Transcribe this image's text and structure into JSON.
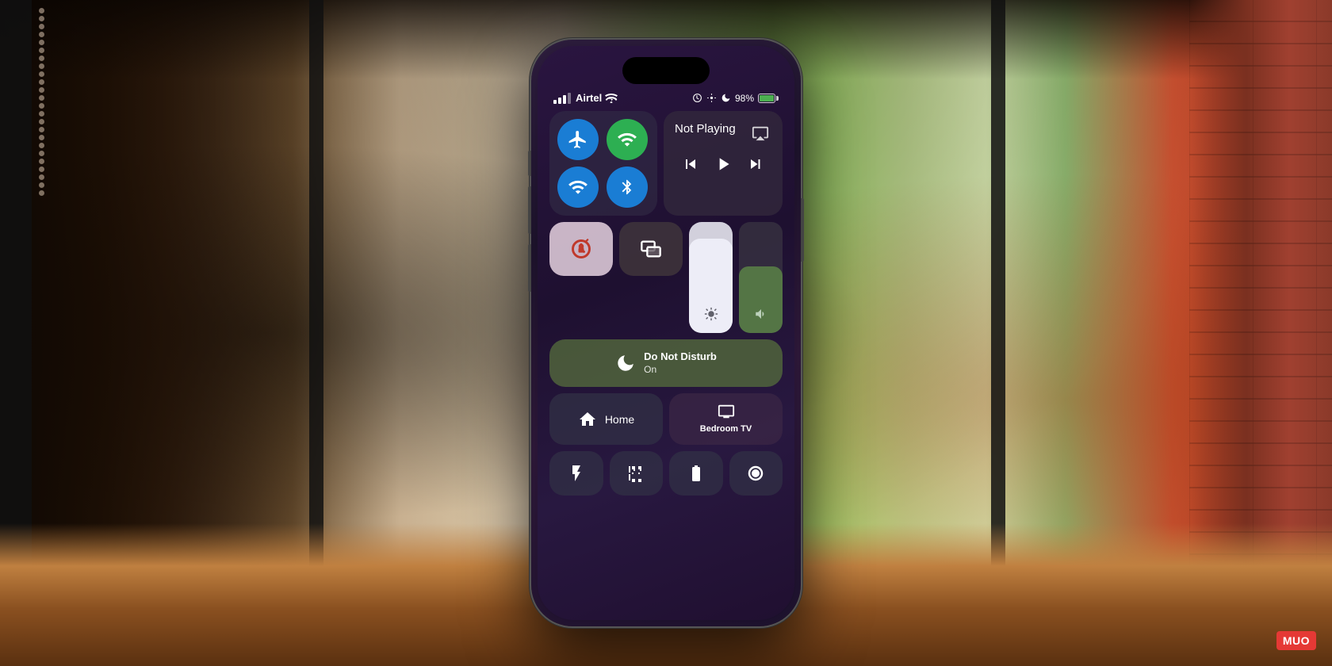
{
  "background": {
    "description": "Indoor scene with window, green trees outside, brick wall right side, wooden table"
  },
  "phone": {
    "carrier": "Airtel",
    "battery_percent": "98%",
    "status_icons": [
      "alarm",
      "focus",
      "moon"
    ]
  },
  "control_center": {
    "connectivity": {
      "airplane_mode": {
        "label": "Airplane Mode",
        "active": true
      },
      "cellular": {
        "label": "Cellular",
        "active": true
      },
      "wifi": {
        "label": "Wi-Fi",
        "active": true
      },
      "bluetooth": {
        "label": "Bluetooth",
        "active": true
      }
    },
    "media": {
      "not_playing_text": "Not Playing",
      "airplay_label": "AirPlay"
    },
    "media_controls": {
      "rewind": "⏮",
      "play": "▶",
      "fast_forward": "⏭"
    },
    "rotation_lock": {
      "label": "Rotation Lock",
      "active": true
    },
    "screen_mirror": {
      "label": "Screen Mirror"
    },
    "do_not_disturb": {
      "label": "Do Not Disturb",
      "status": "On"
    },
    "brightness": {
      "label": "Brightness",
      "level": 85
    },
    "volume": {
      "label": "Volume",
      "level": 60
    },
    "home": {
      "label": "Home"
    },
    "bedroom_tv": {
      "label": "Bedroom TV"
    },
    "bottom_tiles": [
      {
        "label": "Flashlight",
        "icon": "flashlight"
      },
      {
        "label": "QR Scanner",
        "icon": "qr"
      },
      {
        "label": "Battery",
        "icon": "battery"
      },
      {
        "label": "Record",
        "icon": "record"
      }
    ]
  },
  "watermark": {
    "text": "MUO"
  }
}
